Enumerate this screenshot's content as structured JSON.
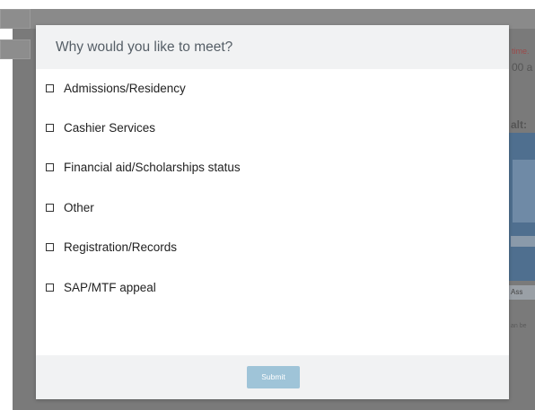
{
  "background": {
    "side_texts": [
      "time.",
      "00 a",
      "alt:",
      "Ass",
      "an be"
    ]
  },
  "modal": {
    "title": "Why would you like to meet?",
    "options": [
      {
        "label": "Admissions/Residency",
        "checked": false
      },
      {
        "label": "Cashier Services",
        "checked": false
      },
      {
        "label": "Financial aid/Scholarships status",
        "checked": false
      },
      {
        "label": "Other",
        "checked": false
      },
      {
        "label": "Registration/Records",
        "checked": false
      },
      {
        "label": "SAP/MTF appeal",
        "checked": false
      }
    ],
    "submit_label": "Submit"
  },
  "colors": {
    "overlay": "#7a7a7a",
    "header_bg": "#f1f2f3",
    "submit_bg": "#9fc4d8"
  }
}
